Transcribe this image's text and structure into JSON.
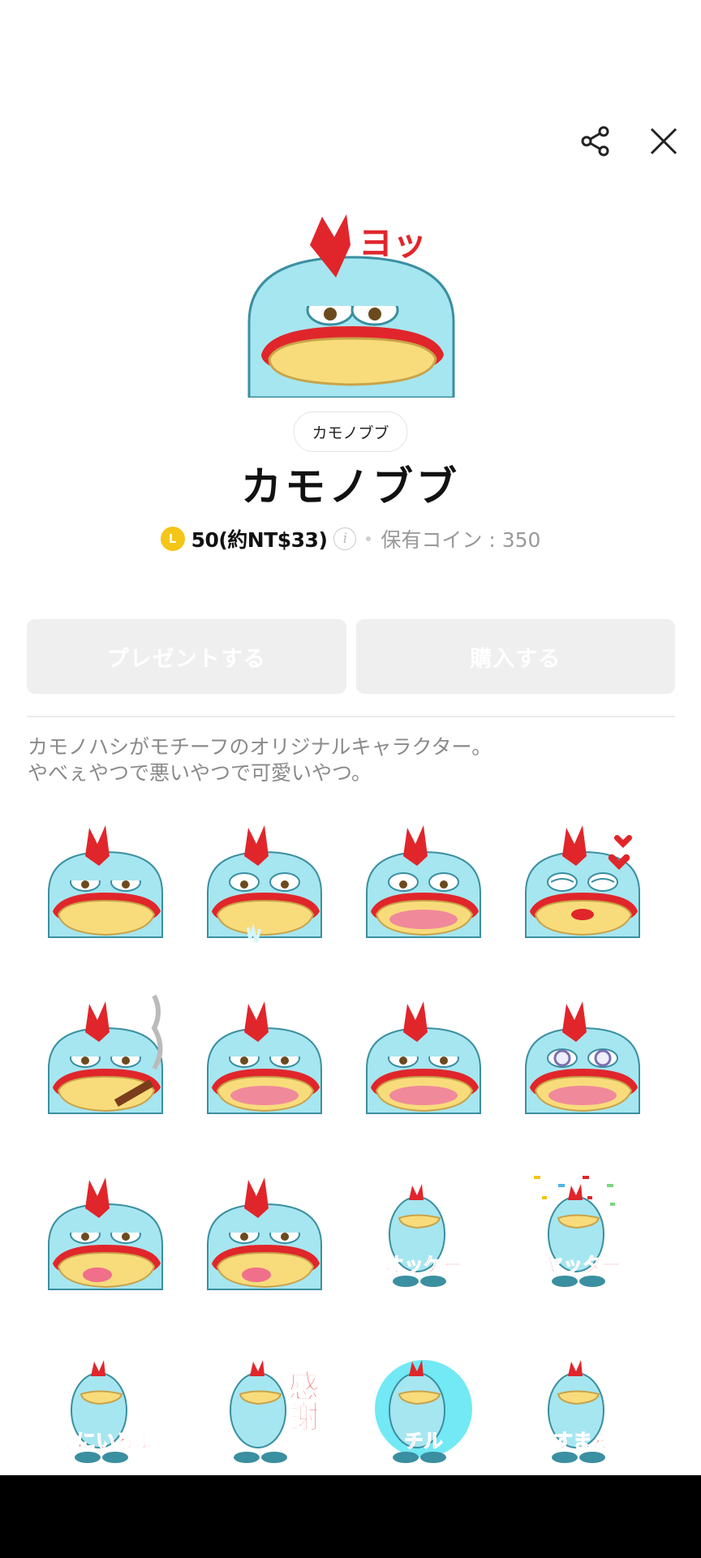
{
  "header": {
    "share_icon": "share-icon",
    "close_icon": "close-icon"
  },
  "hero": {
    "caption": "ヨッ"
  },
  "author": "カモノブブ",
  "title": "カモノブブ",
  "pricing": {
    "coin_letter": "L",
    "price": "50(約NT$33)",
    "info_icon": "i",
    "owned": "保有コイン : 350"
  },
  "buttons": {
    "present": "プレゼントする",
    "buy": "購入する"
  },
  "description": {
    "line1": "カモノハシがモチーフのオリジナルキャラクター。",
    "line2": "やべぇやつで悪いやつで可愛いやつ。"
  },
  "stickers": [
    {
      "caption": ""
    },
    {
      "caption": ""
    },
    {
      "caption": ""
    },
    {
      "caption": ""
    },
    {
      "caption": ""
    },
    {
      "caption": ""
    },
    {
      "caption": ""
    },
    {
      "caption": ""
    },
    {
      "caption": ""
    },
    {
      "caption": ""
    },
    {
      "caption": "オッケー"
    },
    {
      "caption": "ヤッター"
    },
    {
      "caption": "家にいるよ"
    },
    {
      "caption": "感謝"
    },
    {
      "caption": "チル"
    },
    {
      "caption": "すまん"
    }
  ],
  "colors": {
    "body_blue": "#a6e6f0",
    "crest_red": "#e0262b",
    "bill_yellow": "#f8dc7c",
    "coin_gold": "#f5c518"
  }
}
